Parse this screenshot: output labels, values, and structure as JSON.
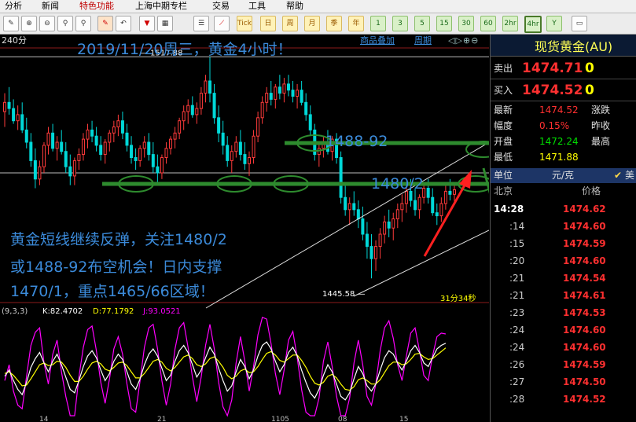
{
  "menu": {
    "items": [
      "分析",
      "新闻",
      "特色功能",
      "上海中期专栏",
      "交易",
      "工具",
      "帮助"
    ],
    "active_index": 2
  },
  "toolbar": {
    "buttons": [
      {
        "icon": "pencil-icon"
      },
      {
        "icon": "zoom-in-icon"
      },
      {
        "icon": "zoom-out-icon"
      },
      {
        "icon": "pen-icon"
      },
      {
        "icon": "funnel-icon"
      },
      {
        "icon": "chart-icon"
      },
      {
        "icon": "grid-icon"
      },
      {
        "icon": "trend-icon"
      },
      {
        "icon": "tick-icon",
        "text": "Tick"
      },
      {
        "icon": "day-icon",
        "text": "日"
      },
      {
        "icon": "week-icon",
        "text": "周"
      },
      {
        "icon": "month-icon",
        "text": "月"
      },
      {
        "icon": "season-icon",
        "text": "季"
      },
      {
        "icon": "year-icon",
        "text": "年"
      },
      {
        "icon": "m1-icon",
        "text": "1"
      },
      {
        "icon": "m3-icon",
        "text": "3"
      },
      {
        "icon": "m5-icon",
        "text": "5"
      },
      {
        "icon": "m15-icon",
        "text": "15"
      },
      {
        "icon": "m30-icon",
        "text": "30"
      },
      {
        "icon": "h1-icon",
        "text": "60"
      },
      {
        "icon": "h2-icon",
        "text": "2hr"
      },
      {
        "icon": "h4-icon",
        "text": "4hr"
      },
      {
        "icon": "settings-icon",
        "text": "Y"
      },
      {
        "icon": "window-icon",
        "text": ""
      }
    ]
  },
  "chart": {
    "period": "240分",
    "links": {
      "overlay": "商品叠加",
      "cycle": "周期"
    },
    "headline": "2019/11/20周三，黄金4小时！",
    "high_label": "1517.88",
    "low_label": "1445.58",
    "level1": "1488-92",
    "level2": "1480/2",
    "comment": [
      "黄金短线继续反弹，关注1480/2",
      "或1488-92布空机会！日内支撑",
      "1470/1，重点1465/66区域！"
    ],
    "countdown": "31分34秒",
    "kdj": {
      "params": "(9,3,3)",
      "k": "K:82.4702",
      "d": "D:77.1792",
      "j": "J:93.0521"
    },
    "x_ticks": [
      "14",
      "21",
      "1105",
      "08",
      "15"
    ]
  },
  "panel": {
    "title": "现货黄金(AU)",
    "sell": {
      "label": "卖出",
      "value": "1474.71",
      "qty": "0"
    },
    "buy": {
      "label": "买入",
      "value": "1474.52",
      "qty": "0"
    },
    "stats": [
      {
        "l1": "最新",
        "v1": "1474.52",
        "c1": "red",
        "l2": "涨跌"
      },
      {
        "l1": "幅度",
        "v1": "0.15%",
        "c1": "red",
        "l2": "昨收"
      },
      {
        "l1": "开盘",
        "v1": "1472.24",
        "c1": "green",
        "l2": "最高"
      },
      {
        "l1": "最低",
        "v1": "1471.88",
        "c1": "yellow",
        "l2": ""
      }
    ],
    "unit_label": "单位",
    "unit": "元/克",
    "mei": "美",
    "col_city": "北京",
    "col_price": "价格",
    "ticks": [
      {
        "t": "14:28",
        "p": "1474.62"
      },
      {
        "t": ":14",
        "p": "1474.60"
      },
      {
        "t": ":15",
        "p": "1474.59"
      },
      {
        "t": ":20",
        "p": "1474.60"
      },
      {
        "t": ":21",
        "p": "1474.54"
      },
      {
        "t": ":21",
        "p": "1474.61"
      },
      {
        "t": ":23",
        "p": "1474.53"
      },
      {
        "t": ":24",
        "p": "1474.60"
      },
      {
        "t": ":24",
        "p": "1474.60"
      },
      {
        "t": ":26",
        "p": "1474.59"
      },
      {
        "t": ":27",
        "p": "1474.50"
      },
      {
        "t": ":28",
        "p": "1474.52"
      }
    ]
  },
  "chart_data": {
    "type": "candlestick",
    "y_range": [
      1440,
      1520
    ],
    "candles": [
      [
        1500,
        1506,
        1495,
        1503
      ],
      [
        1503,
        1508,
        1499,
        1501
      ],
      [
        1501,
        1504,
        1496,
        1497
      ],
      [
        1497,
        1502,
        1494,
        1499
      ],
      [
        1499,
        1503,
        1493,
        1494
      ],
      [
        1494,
        1498,
        1488,
        1490
      ],
      [
        1490,
        1493,
        1482,
        1484
      ],
      [
        1484,
        1488,
        1475,
        1478
      ],
      [
        1478,
        1484,
        1476,
        1482
      ],
      [
        1482,
        1490,
        1480,
        1489
      ],
      [
        1489,
        1495,
        1486,
        1493
      ],
      [
        1493,
        1496,
        1487,
        1488
      ],
      [
        1488,
        1492,
        1484,
        1490
      ],
      [
        1490,
        1494,
        1486,
        1487
      ],
      [
        1487,
        1490,
        1480,
        1482
      ],
      [
        1482,
        1486,
        1476,
        1479
      ],
      [
        1479,
        1485,
        1476,
        1484
      ],
      [
        1484,
        1488,
        1481,
        1486
      ],
      [
        1486,
        1493,
        1484,
        1491
      ],
      [
        1491,
        1496,
        1488,
        1494
      ],
      [
        1494,
        1497,
        1490,
        1492
      ],
      [
        1492,
        1495,
        1487,
        1489
      ],
      [
        1489,
        1492,
        1484,
        1486
      ],
      [
        1486,
        1491,
        1483,
        1490
      ],
      [
        1490,
        1494,
        1487,
        1493
      ],
      [
        1493,
        1497,
        1490,
        1495
      ],
      [
        1495,
        1499,
        1492,
        1497
      ],
      [
        1497,
        1500,
        1491,
        1493
      ],
      [
        1493,
        1496,
        1487,
        1489
      ],
      [
        1489,
        1492,
        1483,
        1485
      ],
      [
        1485,
        1488,
        1481,
        1484
      ],
      [
        1484,
        1489,
        1482,
        1488
      ],
      [
        1488,
        1492,
        1485,
        1490
      ],
      [
        1490,
        1493,
        1484,
        1486
      ],
      [
        1486,
        1490,
        1480,
        1482
      ],
      [
        1482,
        1486,
        1477,
        1480
      ],
      [
        1480,
        1486,
        1478,
        1485
      ],
      [
        1485,
        1490,
        1483,
        1488
      ],
      [
        1488,
        1492,
        1486,
        1491
      ],
      [
        1491,
        1495,
        1488,
        1493
      ],
      [
        1493,
        1498,
        1491,
        1497
      ],
      [
        1497,
        1502,
        1494,
        1500
      ],
      [
        1500,
        1504,
        1496,
        1502
      ],
      [
        1502,
        1505,
        1498,
        1499
      ],
      [
        1499,
        1503,
        1496,
        1501
      ],
      [
        1501,
        1508,
        1499,
        1506
      ],
      [
        1506,
        1512,
        1503,
        1510
      ],
      [
        1510,
        1517.88,
        1503,
        1506
      ],
      [
        1506,
        1509,
        1496,
        1498
      ],
      [
        1498,
        1502,
        1490,
        1493
      ],
      [
        1493,
        1497,
        1486,
        1489
      ],
      [
        1489,
        1492,
        1482,
        1484
      ],
      [
        1484,
        1489,
        1480,
        1487
      ],
      [
        1487,
        1492,
        1485,
        1490
      ],
      [
        1490,
        1494,
        1484,
        1486
      ],
      [
        1486,
        1490,
        1481,
        1483
      ],
      [
        1483,
        1487,
        1479,
        1485
      ],
      [
        1485,
        1494,
        1483,
        1492
      ],
      [
        1492,
        1500,
        1490,
        1498
      ],
      [
        1498,
        1505,
        1496,
        1503
      ],
      [
        1503,
        1508,
        1500,
        1506
      ],
      [
        1506,
        1510,
        1502,
        1504
      ],
      [
        1504,
        1509,
        1501,
        1508
      ],
      [
        1508,
        1512,
        1504,
        1506
      ],
      [
        1506,
        1511,
        1503,
        1509
      ],
      [
        1509,
        1512,
        1505,
        1507
      ],
      [
        1507,
        1510,
        1503,
        1505
      ],
      [
        1505,
        1509,
        1501,
        1507
      ],
      [
        1507,
        1510,
        1502,
        1503
      ],
      [
        1503,
        1506,
        1497,
        1499
      ],
      [
        1499,
        1502,
        1492,
        1494
      ],
      [
        1494,
        1496,
        1484,
        1486
      ],
      [
        1486,
        1490,
        1482,
        1488
      ],
      [
        1488,
        1492,
        1485,
        1490
      ],
      [
        1490,
        1494,
        1486,
        1487
      ],
      [
        1487,
        1492,
        1484,
        1491
      ],
      [
        1491,
        1493,
        1483,
        1485
      ],
      [
        1485,
        1487,
        1470,
        1472
      ],
      [
        1472,
        1476,
        1466,
        1468
      ],
      [
        1468,
        1472,
        1463,
        1470
      ],
      [
        1470,
        1474,
        1466,
        1468
      ],
      [
        1468,
        1471,
        1462,
        1465
      ],
      [
        1465,
        1469,
        1458,
        1460
      ],
      [
        1460,
        1464,
        1452,
        1456
      ],
      [
        1456,
        1460,
        1445.58,
        1452
      ],
      [
        1452,
        1458,
        1448,
        1456
      ],
      [
        1456,
        1462,
        1452,
        1460
      ],
      [
        1460,
        1466,
        1457,
        1464
      ],
      [
        1464,
        1468,
        1459,
        1462
      ],
      [
        1462,
        1467,
        1458,
        1465
      ],
      [
        1465,
        1470,
        1462,
        1468
      ],
      [
        1468,
        1473,
        1464,
        1470
      ],
      [
        1470,
        1476,
        1467,
        1474
      ],
      [
        1474,
        1478,
        1469,
        1471
      ],
      [
        1471,
        1475,
        1466,
        1468
      ],
      [
        1468,
        1473,
        1465,
        1472
      ],
      [
        1472,
        1477,
        1470,
        1475
      ],
      [
        1475,
        1478,
        1470,
        1472
      ],
      [
        1472,
        1475,
        1466,
        1467
      ],
      [
        1467,
        1470,
        1463,
        1466
      ],
      [
        1466,
        1472,
        1464,
        1470
      ],
      [
        1470,
        1476,
        1468,
        1474
      ],
      [
        1474,
        1478,
        1471,
        1473
      ],
      [
        1473,
        1476,
        1470,
        1474.52
      ]
    ],
    "kdj_k": [
      45,
      52,
      40,
      30,
      24,
      38,
      55,
      65,
      72,
      60,
      50,
      62,
      70,
      58,
      44,
      30,
      26,
      40,
      56,
      68,
      74,
      66,
      52,
      40,
      48,
      62,
      70,
      64,
      50,
      36,
      30,
      42,
      58,
      70,
      76,
      68,
      54,
      40,
      46,
      62,
      74,
      80,
      72,
      58,
      44,
      52,
      66,
      78,
      70,
      54,
      40,
      28,
      34,
      50,
      64,
      56,
      42,
      52,
      68,
      80,
      84,
      76,
      62,
      50,
      58,
      72,
      78,
      68,
      52,
      38,
      26,
      20,
      30,
      46,
      58,
      50,
      36,
      22,
      18,
      26,
      42,
      56,
      48,
      34,
      28,
      36,
      52,
      66,
      74,
      70,
      60,
      52,
      62,
      74,
      80,
      72,
      60,
      56,
      66,
      76,
      80,
      82.47
    ],
    "kdj_d": [
      48,
      50,
      46,
      40,
      34,
      35,
      42,
      50,
      58,
      60,
      57,
      58,
      62,
      61,
      55,
      46,
      39,
      39,
      45,
      53,
      60,
      62,
      59,
      53,
      51,
      55,
      60,
      61,
      57,
      50,
      43,
      43,
      48,
      55,
      62,
      64,
      61,
      54,
      51,
      55,
      61,
      67,
      69,
      65,
      58,
      56,
      59,
      65,
      67,
      62,
      55,
      46,
      42,
      45,
      51,
      53,
      49,
      50,
      56,
      64,
      71,
      73,
      69,
      63,
      61,
      65,
      69,
      69,
      63,
      55,
      45,
      37,
      35,
      38,
      45,
      47,
      43,
      36,
      30,
      29,
      33,
      41,
      43,
      40,
      36,
      36,
      41,
      49,
      57,
      61,
      61,
      58,
      59,
      64,
      70,
      71,
      67,
      64,
      65,
      69,
      73,
      77.18
    ],
    "kdj_j": [
      40,
      58,
      28,
      12,
      8,
      45,
      80,
      95,
      100,
      60,
      36,
      70,
      86,
      50,
      22,
      0,
      0,
      44,
      78,
      98,
      102,
      74,
      38,
      14,
      42,
      76,
      90,
      70,
      36,
      8,
      4,
      40,
      78,
      100,
      104,
      76,
      40,
      12,
      36,
      76,
      100,
      106,
      78,
      44,
      16,
      44,
      80,
      104,
      76,
      38,
      10,
      0,
      18,
      60,
      90,
      62,
      28,
      56,
      92,
      112,
      110,
      82,
      48,
      24,
      52,
      86,
      96,
      66,
      30,
      4,
      0,
      0,
      20,
      62,
      84,
      56,
      22,
      0,
      0,
      20,
      60,
      86,
      58,
      22,
      12,
      36,
      74,
      100,
      108,
      88,
      58,
      40,
      68,
      94,
      100,
      74,
      46,
      40,
      68,
      90,
      94,
      93.05
    ]
  }
}
